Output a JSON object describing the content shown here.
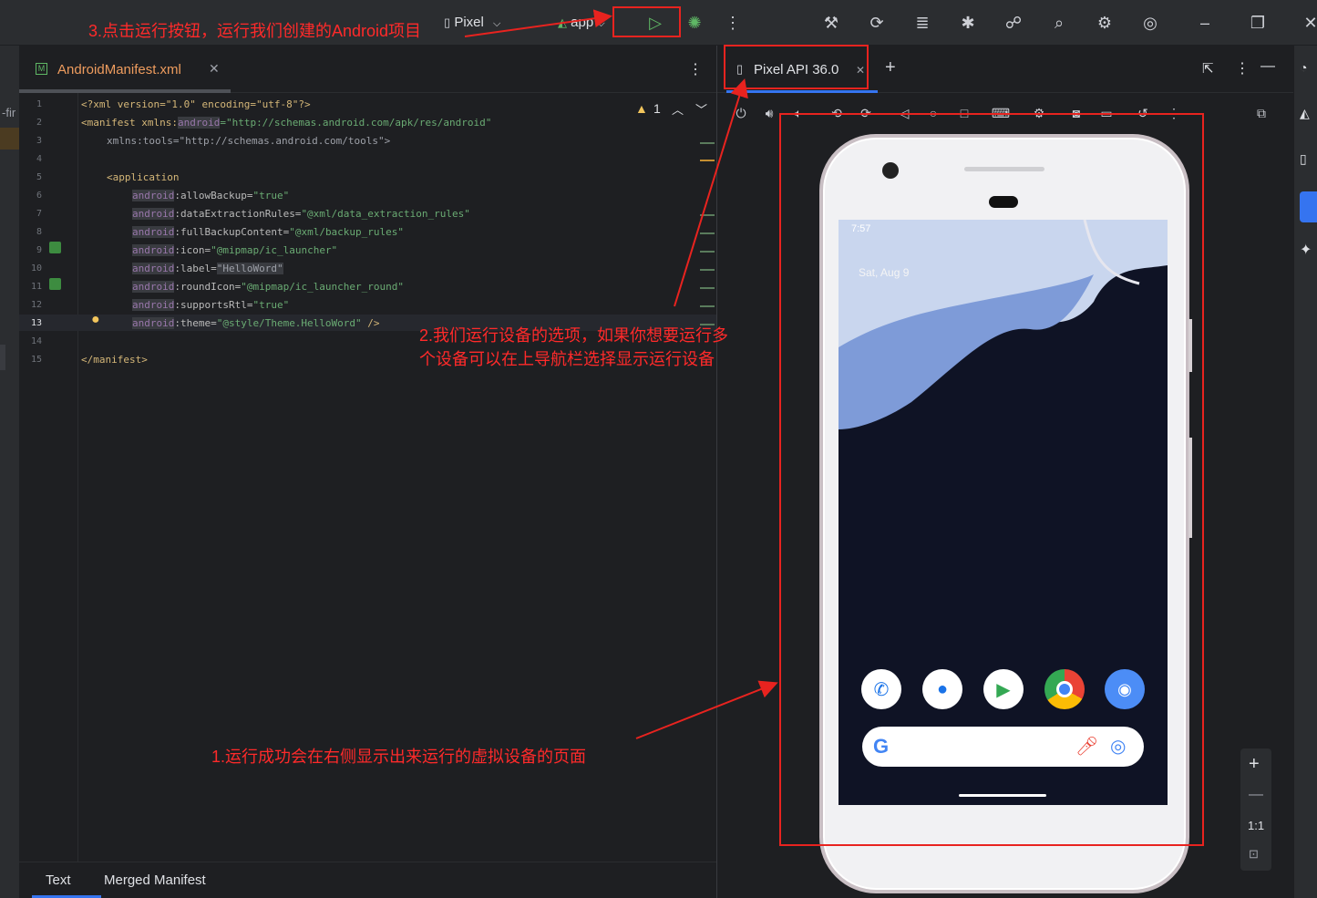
{
  "toolbar": {
    "device": "Pixel",
    "config": "app"
  },
  "editor": {
    "tab": "AndroidManifest.xml",
    "warnings": "1",
    "bottom_tabs": [
      "Text",
      "Merged Manifest"
    ],
    "left_fragment": "-fir",
    "line_numbers": [
      "1",
      "2",
      "3",
      "4",
      "5",
      "6",
      "7",
      "8",
      "9",
      "10",
      "11",
      "12",
      "13",
      "14",
      "15"
    ],
    "lines": {
      "l1": "<?xml version=\"1.0\" encoding=\"utf-8\"?>",
      "l2a": "<manifest xmlns:",
      "l2b": "android",
      "l2c": "=\"http://schemas.android.com/apk/res/android\"",
      "l3": "xmlns:tools=\"http://schemas.android.com/tools\">",
      "l5": "<application",
      "l6a": "android",
      "l6b": ":allowBackup=",
      "l6c": "\"true\"",
      "l7a": "android",
      "l7b": ":dataExtractionRules=",
      "l7c": "\"@xml/data_extraction_rules\"",
      "l8a": "android",
      "l8b": ":fullBackupContent=",
      "l8c": "\"@xml/backup_rules\"",
      "l9a": "android",
      "l9b": ":icon=",
      "l9c": "\"@mipmap/ic_launcher\"",
      "l10a": "android",
      "l10b": ":label=",
      "l10c": "\"HelloWord\"",
      "l11a": "android",
      "l11b": ":roundIcon=",
      "l11c": "\"@mipmap/ic_launcher_round\"",
      "l12a": "android",
      "l12b": ":supportsRtl=",
      "l12c": "\"true\"",
      "l13a": "android",
      "l13b": ":theme=",
      "l13c": "\"@style/Theme.HelloWord\"",
      "l13d": " />",
      "l15": "</manifest>"
    }
  },
  "running_devices": {
    "tab": "Pixel API 36.0",
    "zoom_label": "1:1"
  },
  "phone": {
    "time": "7:57",
    "date": "Sat, Aug 9"
  },
  "annotations": {
    "a1": "1.运行成功会在右侧显示出来运行的虚拟设备的页面",
    "a2_line1": "2.我们运行设备的选项，如果你想要运行多",
    "a2_line2": "个设备可以在上导航栏选择显示运行设备",
    "a3": "3.点击运行按钮，运行我们创建的Android项目"
  },
  "colors": {
    "annotation": "#ff2a2a",
    "run_green": "#5fb865"
  }
}
